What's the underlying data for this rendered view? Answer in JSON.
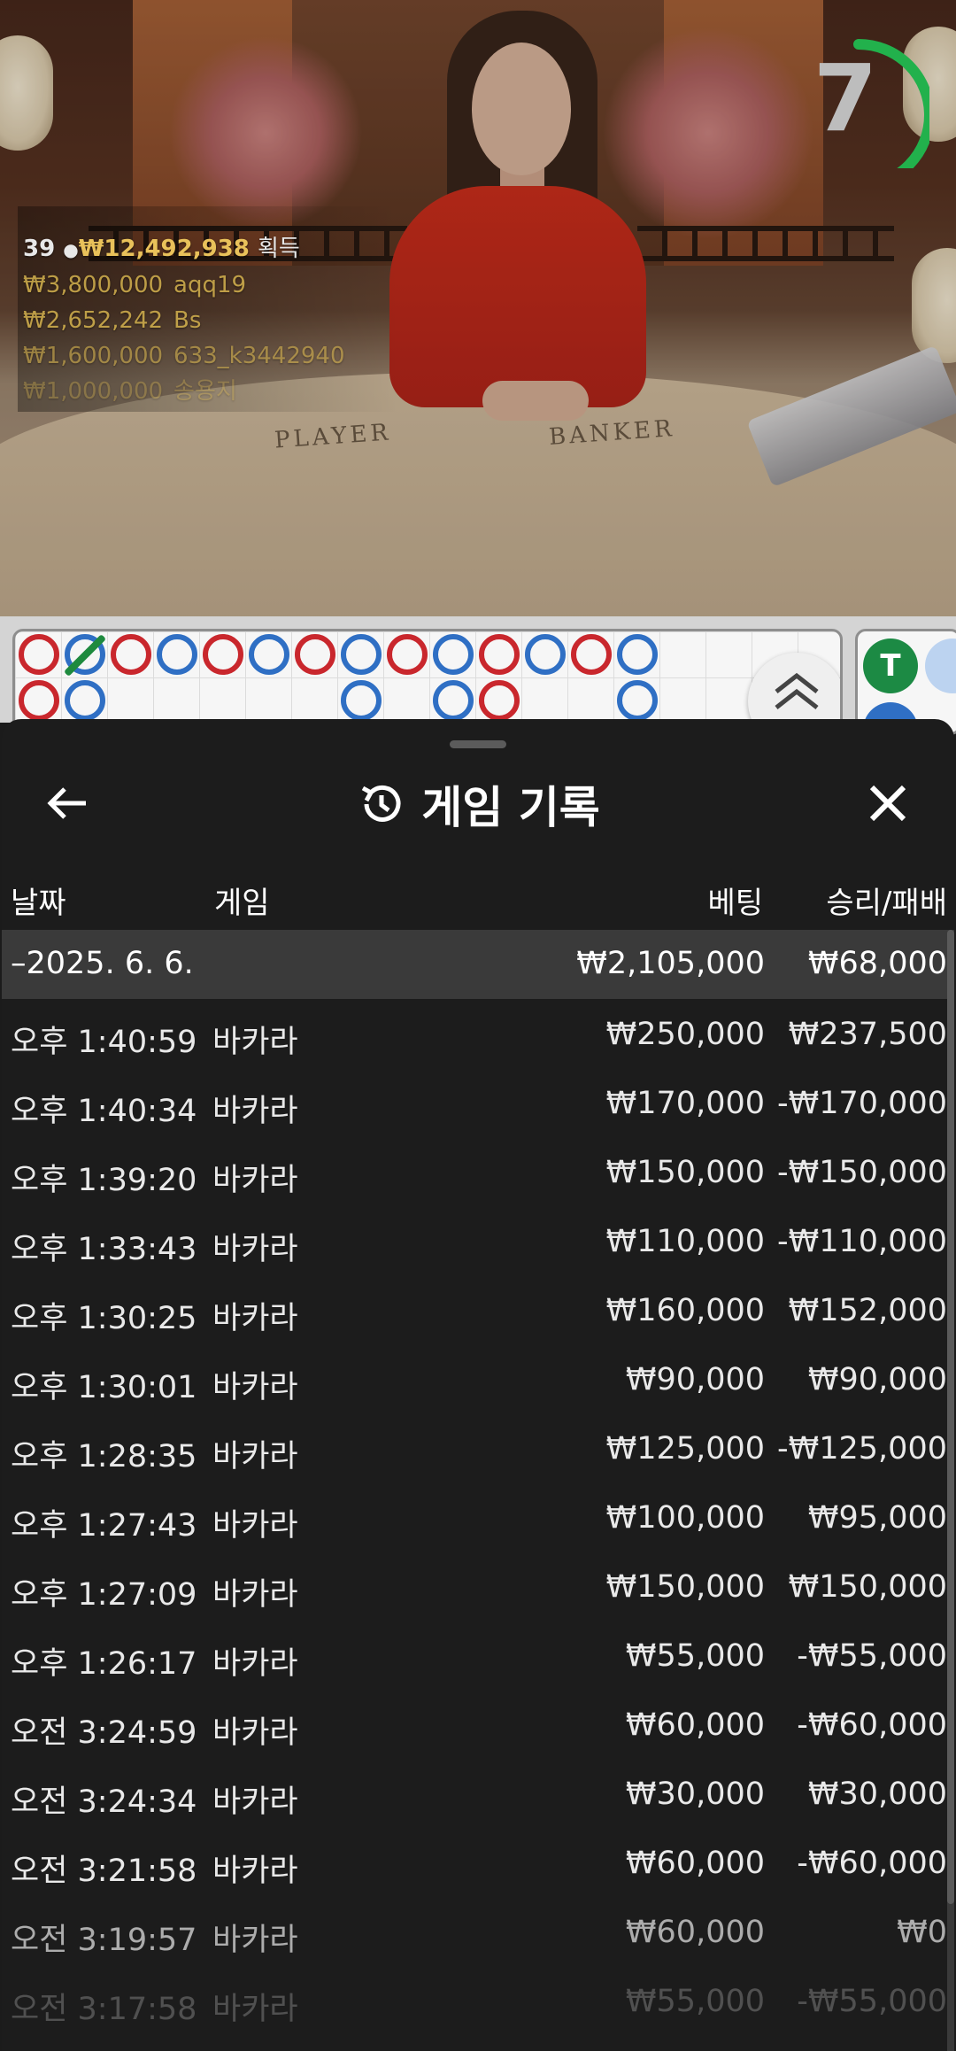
{
  "overlay": {
    "total_count": "39",
    "total_amount": "₩12,492,938",
    "total_suffix": "획득",
    "winners": [
      {
        "amount": "₩3,800,000",
        "name": "aqq19"
      },
      {
        "amount": "₩2,652,242",
        "name": "Bs"
      },
      {
        "amount": "₩1,600,000",
        "name": "633_k3442940"
      },
      {
        "amount": "₩1,000,000",
        "name": "송용지"
      }
    ]
  },
  "table": {
    "player_label": "PLAYER",
    "banker_label": "BANKER"
  },
  "timer": {
    "value": "7",
    "progress_fraction": 0.55,
    "color": "#22b14c"
  },
  "roadmap": {
    "tie_label": "T"
  },
  "history": {
    "title": "게임 기록",
    "columns": {
      "date": "날짜",
      "game": "게임",
      "bet": "베팅",
      "result": "승리/패배"
    },
    "date_group": {
      "date": "–2025. 6. 6.",
      "bet": "₩2,105,000",
      "result": "₩68,000"
    },
    "rows": [
      {
        "time": "오후 1:40:59",
        "game": "바카라",
        "bet": "₩250,000",
        "result": "₩237,500"
      },
      {
        "time": "오후 1:40:34",
        "game": "바카라",
        "bet": "₩170,000",
        "result": "-₩170,000"
      },
      {
        "time": "오후 1:39:20",
        "game": "바카라",
        "bet": "₩150,000",
        "result": "-₩150,000"
      },
      {
        "time": "오후 1:33:43",
        "game": "바카라",
        "bet": "₩110,000",
        "result": "-₩110,000"
      },
      {
        "time": "오후 1:30:25",
        "game": "바카라",
        "bet": "₩160,000",
        "result": "₩152,000"
      },
      {
        "time": "오후 1:30:01",
        "game": "바카라",
        "bet": "₩90,000",
        "result": "₩90,000"
      },
      {
        "time": "오후 1:28:35",
        "game": "바카라",
        "bet": "₩125,000",
        "result": "-₩125,000"
      },
      {
        "time": "오후 1:27:43",
        "game": "바카라",
        "bet": "₩100,000",
        "result": "₩95,000"
      },
      {
        "time": "오후 1:27:09",
        "game": "바카라",
        "bet": "₩150,000",
        "result": "₩150,000"
      },
      {
        "time": "오후 1:26:17",
        "game": "바카라",
        "bet": "₩55,000",
        "result": "-₩55,000"
      },
      {
        "time": "오전 3:24:59",
        "game": "바카라",
        "bet": "₩60,000",
        "result": "-₩60,000"
      },
      {
        "time": "오전 3:24:34",
        "game": "바카라",
        "bet": "₩30,000",
        "result": "₩30,000"
      },
      {
        "time": "오전 3:21:58",
        "game": "바카라",
        "bet": "₩60,000",
        "result": "-₩60,000"
      },
      {
        "time": "오전 3:19:57",
        "game": "바카라",
        "bet": "₩60,000",
        "result": "₩0"
      },
      {
        "time": "오전 3:17:58",
        "game": "바카라",
        "bet": "₩55,000",
        "result": "-₩55,000"
      }
    ]
  }
}
